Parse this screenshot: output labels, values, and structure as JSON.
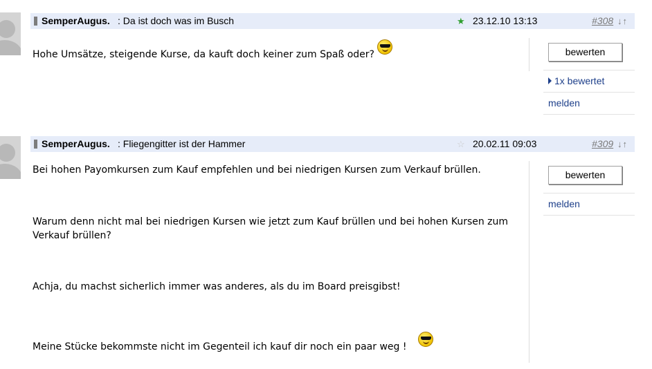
{
  "posts": [
    {
      "author": "SemperAugus.",
      "subject": ": Da ist doch was im Busch",
      "star": "★",
      "star_color": "#2e9e2e",
      "date": "23.12.10 13:13",
      "number": "#308",
      "nav_arrows": "↓↑",
      "text_lines": [
        "Hohe Umsätze, steigende Kurse, da kauft doch keiner zum Spaß oder?"
      ],
      "rate_button": "bewerten",
      "rated_link": "1x bewertet",
      "report_link": "melden"
    },
    {
      "author": "SemperAugus.",
      "subject": ": Fliegengitter ist der Hammer",
      "star": "☆",
      "star_color": "#c8c8c8",
      "date": "20.02.11 09:03",
      "number": "#309",
      "nav_arrows": "↓↑",
      "text_lines": [
        "Bei hohen Payomkursen zum Kauf empfehlen und bei niedrigen Kursen zum Verkauf brüllen.",
        "Warum denn nicht mal bei niedrigen Kursen wie jetzt zum Kauf brüllen und bei hohen Kursen zum Verkauf brüllen?",
        "Achja, du machst sicherlich immer was anderes, als du im Board preisgibst!",
        "Meine Stücke bekommste nicht im Gegenteil ich kauf dir noch ein paar weg !"
      ],
      "rate_button": "bewerten",
      "report_link": "melden"
    }
  ],
  "icons": {
    "avatar": "avatar-placeholder-icon",
    "smiley": "cool-smiley-icon"
  }
}
